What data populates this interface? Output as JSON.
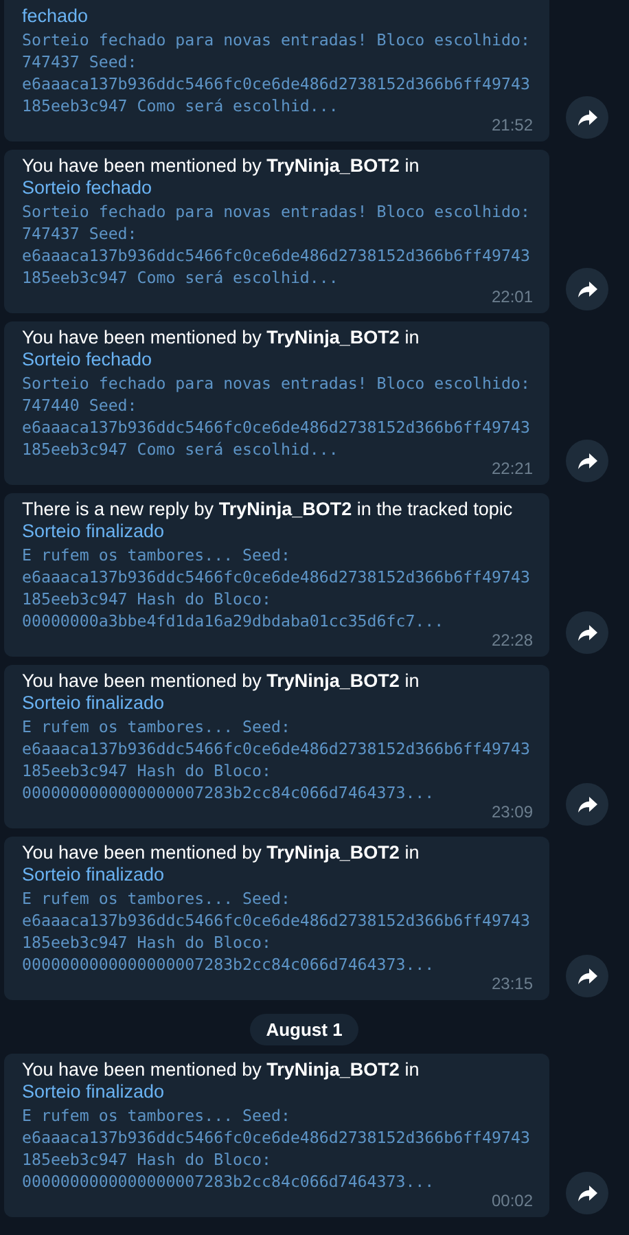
{
  "feed": [
    {
      "kind": "message",
      "header": [
        {
          "kind": "link",
          "text": "fechado"
        }
      ],
      "body": "Sorteio fechado para novas entradas! Bloco escolhido: 747437 Seed: e6aaaca137b936ddc5466fc0ce6de486d2738152d366b6ff49743185eeb3c947 Como será escolhid...",
      "time": "21:52"
    },
    {
      "kind": "message",
      "header": [
        {
          "kind": "text",
          "text": "You have been mentioned by "
        },
        {
          "kind": "bold",
          "text": "TryNinja_BOT2"
        },
        {
          "kind": "text",
          "text": " in "
        },
        {
          "kind": "link",
          "text": "Sorteio fechado"
        }
      ],
      "body": "Sorteio fechado para novas entradas! Bloco escolhido: 747437 Seed: e6aaaca137b936ddc5466fc0ce6de486d2738152d366b6ff49743185eeb3c947 Como será escolhid...",
      "time": "22:01"
    },
    {
      "kind": "message",
      "header": [
        {
          "kind": "text",
          "text": "You have been mentioned by "
        },
        {
          "kind": "bold",
          "text": "TryNinja_BOT2"
        },
        {
          "kind": "text",
          "text": " in "
        },
        {
          "kind": "link",
          "text": "Sorteio fechado"
        }
      ],
      "body": "Sorteio fechado para novas entradas! Bloco escolhido: 747440 Seed: e6aaaca137b936ddc5466fc0ce6de486d2738152d366b6ff49743185eeb3c947 Como será escolhid...",
      "time": "22:21"
    },
    {
      "kind": "message",
      "header": [
        {
          "kind": "text",
          "text": "There is a new reply by "
        },
        {
          "kind": "bold",
          "text": "TryNinja_BOT2"
        },
        {
          "kind": "text",
          "text": " in the tracked topic "
        },
        {
          "kind": "link",
          "text": "Sorteio finalizado"
        }
      ],
      "body": "E rufem os tambores... Seed: e6aaaca137b936ddc5466fc0ce6de486d2738152d366b6ff49743185eeb3c947 Hash do Bloco: 00000000a3bbe4fd1da16a29dbdaba01cc35d6fc7...",
      "time": "22:28"
    },
    {
      "kind": "message",
      "header": [
        {
          "kind": "text",
          "text": "You have been mentioned by "
        },
        {
          "kind": "bold",
          "text": "TryNinja_BOT2"
        },
        {
          "kind": "text",
          "text": " in "
        },
        {
          "kind": "link",
          "text": "Sorteio finalizado"
        }
      ],
      "body": "E rufem os tambores... Seed: e6aaaca137b936ddc5466fc0ce6de486d2738152d366b6ff49743185eeb3c947 Hash do Bloco: 0000000000000000007283b2cc84c066d7464373...",
      "time": "23:09"
    },
    {
      "kind": "message",
      "header": [
        {
          "kind": "text",
          "text": "You have been mentioned by "
        },
        {
          "kind": "bold",
          "text": "TryNinja_BOT2"
        },
        {
          "kind": "text",
          "text": " in "
        },
        {
          "kind": "link",
          "text": "Sorteio finalizado"
        }
      ],
      "body": "E rufem os tambores... Seed: e6aaaca137b936ddc5466fc0ce6de486d2738152d366b6ff49743185eeb3c947 Hash do Bloco: 0000000000000000007283b2cc84c066d7464373...",
      "time": "23:15"
    },
    {
      "kind": "date",
      "text": "August 1"
    },
    {
      "kind": "message",
      "header": [
        {
          "kind": "text",
          "text": "You have been mentioned by "
        },
        {
          "kind": "bold",
          "text": "TryNinja_BOT2"
        },
        {
          "kind": "text",
          "text": " in "
        },
        {
          "kind": "link",
          "text": "Sorteio finalizado"
        }
      ],
      "body": "E rufem os tambores... Seed: e6aaaca137b936ddc5466fc0ce6de486d2738152d366b6ff49743185eeb3c947 Hash do Bloco: 0000000000000000007283b2cc84c066d7464373...",
      "time": "00:02"
    }
  ]
}
